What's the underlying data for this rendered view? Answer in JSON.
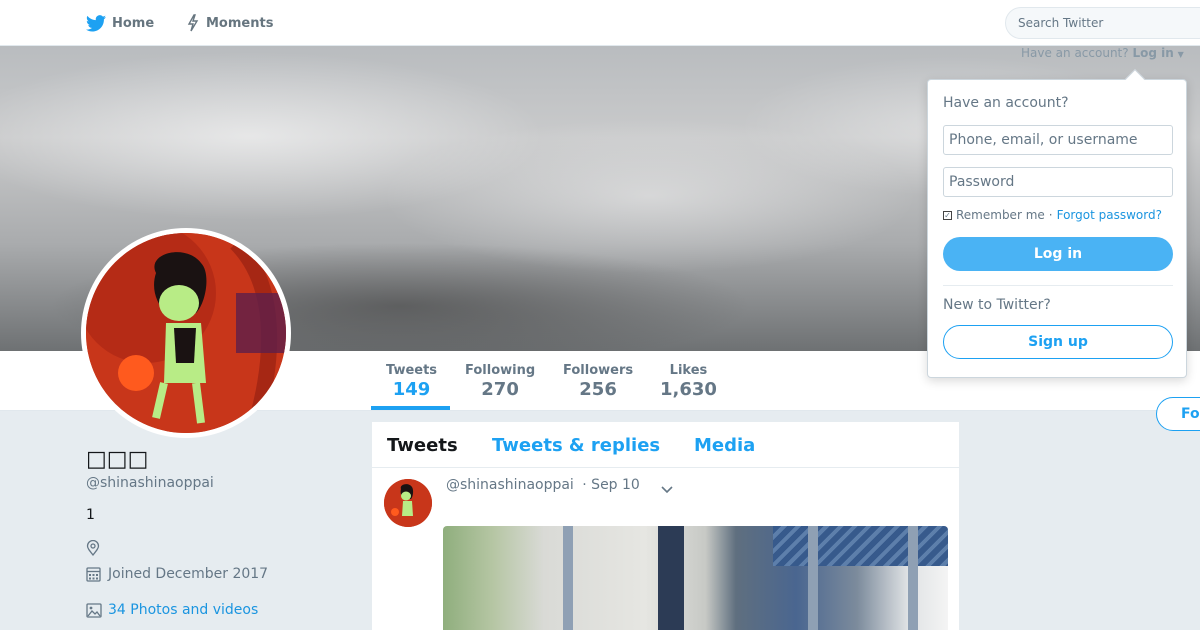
{
  "nav": {
    "home_label": "Home",
    "moments_label": "Moments",
    "search_placeholder": "Search Twitter"
  },
  "account_prompt": {
    "text": "Have an account?",
    "login_label": "Log in"
  },
  "profile": {
    "name": "□□□",
    "handle": "@shinashinaoppai",
    "bio": "1",
    "joined": "Joined December 2017",
    "photos_link": "34 Photos and videos"
  },
  "stats": [
    {
      "label": "Tweets",
      "value": "149"
    },
    {
      "label": "Following",
      "value": "270"
    },
    {
      "label": "Followers",
      "value": "256"
    },
    {
      "label": "Likes",
      "value": "1,630"
    }
  ],
  "follow_button": "Fo",
  "timeline": {
    "tabs": [
      "Tweets",
      "Tweets & replies",
      "Media"
    ],
    "tweet": {
      "handle": "@shinashinaoppai",
      "date": "· Sep 10"
    }
  },
  "login_dropdown": {
    "title": "Have an account?",
    "username_placeholder": "Phone, email, or username",
    "password_placeholder": "Password",
    "remember_label": "Remember me",
    "separator": "·",
    "forgot_label": "Forgot password?",
    "login_button": "Log in",
    "new_prompt": "New to Twitter?",
    "signup_button": "Sign up"
  },
  "colors": {
    "accent": "#1da1f2",
    "login_button": "#4ab3f4",
    "page_background": "#e6ecf0"
  }
}
